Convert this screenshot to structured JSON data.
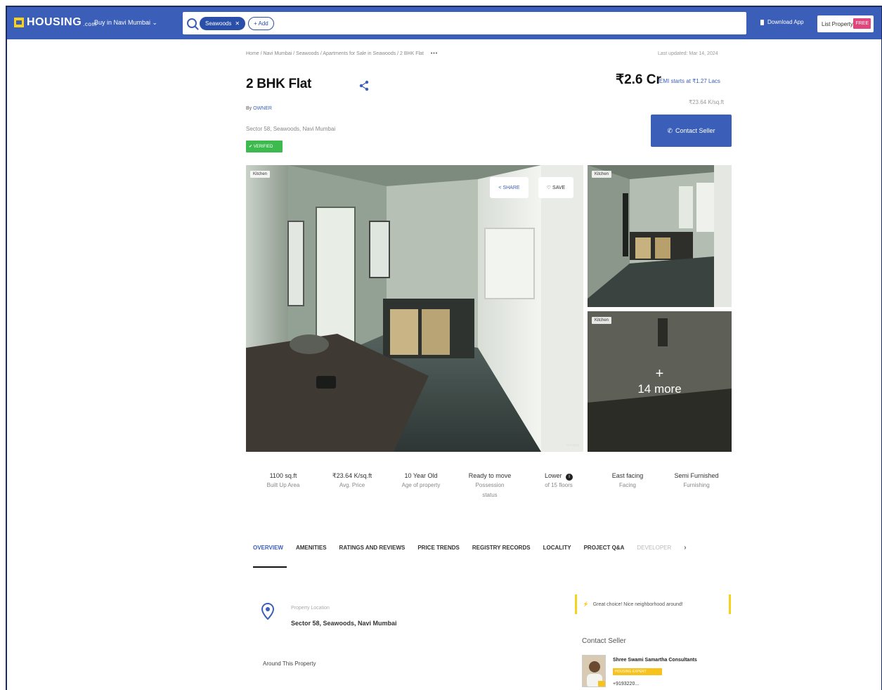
{
  "header": {
    "logo_text": "HOUSING",
    "logo_suffix": ".com",
    "city_selector": "Buy in Navi Mumbai",
    "search_chip": "Seawoods",
    "search_add": "+ Add",
    "download_app": "Download App",
    "list_property": "List Property",
    "free_badge": "FREE"
  },
  "breadcrumb": {
    "path": "Home / Navi Mumbai / Seawoods / Apartments for Sale in Seawoods / 2 BHK Flat",
    "more": "•••"
  },
  "last_updated": "Last updated: Mar 14, 2024",
  "listing": {
    "title": "2 BHK Flat",
    "by_prefix": "By ",
    "seller_link": "OWNER",
    "address": "Sector 58, Seawoods, Navi Mumbai",
    "verified": "✔ VERIFIED",
    "price": "₹2.6 Cr",
    "emi": "EMI starts at ₹1.27 Lacs",
    "per_sqft": "₹23.64 K/sq.ft",
    "contact_button": "Contact Seller"
  },
  "gallery": {
    "main_tag": "Kitchen",
    "share_label": "SHARE",
    "save_label": "SAVE",
    "side1_tag": "Kitchen",
    "side2_tag": "Kitchen",
    "more_plus": "+",
    "more_label": "14 more",
    "watermark": "Housing"
  },
  "facts": [
    {
      "value": "1100 sq.ft",
      "label": "Built Up Area"
    },
    {
      "value": "₹23.64 K/sq.ft",
      "label": "Avg. Price"
    },
    {
      "value": "10 Year Old",
      "label": "Age of property"
    },
    {
      "value": "Ready to move",
      "label": "Possession status"
    },
    {
      "value": "Lower",
      "label": "of 15 floors"
    },
    {
      "value": "East facing",
      "label": "Facing"
    },
    {
      "value": "Semi Furnished",
      "label": "Furnishing"
    }
  ],
  "tabs": [
    {
      "label": "OVERVIEW"
    },
    {
      "label": "AMENITIES"
    },
    {
      "label": "RATINGS AND REVIEWS"
    },
    {
      "label": "PRICE TRENDS"
    },
    {
      "label": "REGISTRY RECORDS"
    },
    {
      "label": "LOCALITY"
    },
    {
      "label": "PROJECT Q&A"
    },
    {
      "label": "DEVELOPER"
    }
  ],
  "overview": {
    "location_label": "Property Location",
    "location_value": "Sector 58, Seawoods, Navi Mumbai",
    "around_label": "Around This Property"
  },
  "sidebar": {
    "tip": "Great choice! Nice neighborhood around!",
    "contact_heading": "Contact Seller",
    "seller_name": "Shree Swami Samartha Consultants",
    "seller_badge": "HOUSING EXPERT",
    "seller_phone": "+9193220..."
  },
  "colors": {
    "brand_blue": "#3b5fb8",
    "verified_green": "#3dba4e",
    "free_pink": "#e0457b",
    "accent_yellow": "#f7d21c"
  }
}
